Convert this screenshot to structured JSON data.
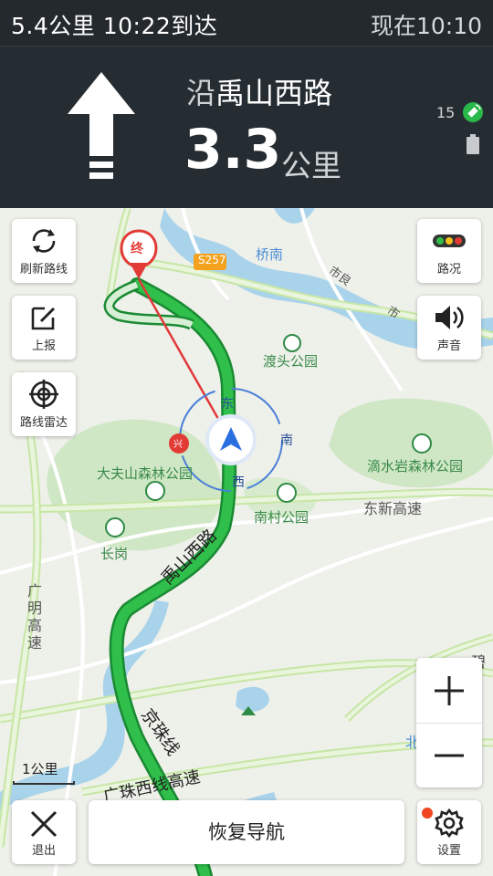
{
  "status": {
    "trip_summary": "5.4公里  10:22到达",
    "current_time": "现在10:10"
  },
  "guidance": {
    "along_prefix": "沿",
    "road_name": "禹山西路",
    "distance_value": "3.3",
    "distance_unit": "公里",
    "satellite_count": "15"
  },
  "side_buttons": {
    "refresh": "刷新路线",
    "report": "上报",
    "radar": "路线雷达",
    "traffic": "路况",
    "sound": "声音"
  },
  "map": {
    "labels": {
      "s257": "S257",
      "qiaonan": "桥南",
      "dutou_park": "渡头公园",
      "dafushan_park": "大夫山森林公园",
      "dishuiyan_park": "滴水岩森林公园",
      "nancun_park": "南村公园",
      "changgang": "长岗",
      "dongxin_expressway": "东新高速",
      "guangming_expressway": "广明高速",
      "yushan_west_road": "禹山西路",
      "jingzhu_line": "京珠线",
      "guangzhu_west_expressway": "广珠西线高速",
      "destination_marker": "终",
      "compass_east": "东",
      "compass_south": "南",
      "compass_west": "西",
      "compass_north": "北",
      "transit_marker": "兴",
      "bi": "碧",
      "shijiao": "市良",
      "shi": "市"
    },
    "scale_label": "1公里"
  },
  "bottom": {
    "exit": "退出",
    "resume": "恢复导航",
    "settings": "设置"
  },
  "colors": {
    "route": "#2fbf4a",
    "route_border": "#1a8a33",
    "direct_line": "#e03a3a",
    "accent_blue": "#2a6fe0",
    "panel_bg": "#262d32"
  }
}
